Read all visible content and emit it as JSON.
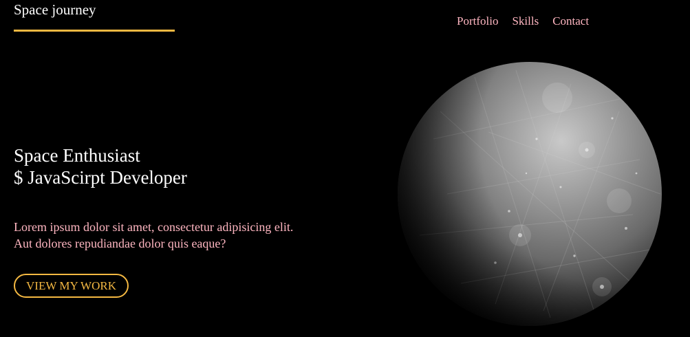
{
  "header": {
    "logo": "Space journey",
    "nav": [
      "Portfolio",
      "Skills",
      "Contact"
    ]
  },
  "hero": {
    "title_line1": "Space Enthusiast",
    "title_line2": "$ JavaScirpt Developer",
    "desc_line1": "Lorem ipsum dolor sit amet, consectetur adipisicing elit.",
    "desc_line2": "Aut dolores repudiandae dolor quis eaque?",
    "cta_label": "VIEW MY WORK"
  },
  "colors": {
    "background": "#000000",
    "accent": "#f5b942",
    "nav_text": "#ffb6c1",
    "desc_text": "#ffb6c1",
    "heading_text": "#ffffff"
  },
  "image": {
    "subject": "planet-mercury"
  }
}
